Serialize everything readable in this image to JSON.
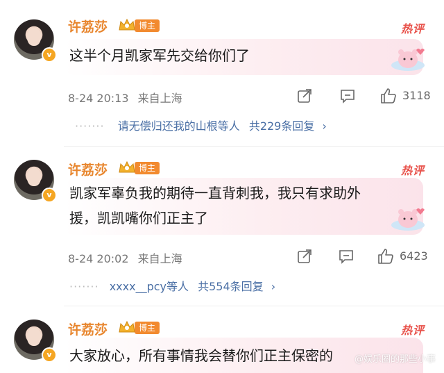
{
  "comments": [
    {
      "username": "许荔莎",
      "badge": "博主",
      "hot_label": "热评",
      "text_lines": [
        "这半个月凯家军先交给你们了"
      ],
      "timestamp": "8-24 20:13",
      "source": "来自上海",
      "likes": "3118",
      "replies_text": "请无偿归还我的山根等人",
      "replies_count": "共229条回复",
      "replies_chevron": "›"
    },
    {
      "username": "许荔莎",
      "badge": "博主",
      "hot_label": "热评",
      "text_lines": [
        "凯家军辜负我的期待一直背刺我，我只有求助外",
        "援，凯凯嘴你们正主了"
      ],
      "timestamp": "8-24 20:02",
      "source": "来自上海",
      "likes": "6423",
      "replies_text": "xxxx__pcy等人",
      "replies_count": "共554条回复",
      "replies_chevron": "›"
    },
    {
      "username": "许荔莎",
      "badge": "博主",
      "hot_label": "热评",
      "text_lines": [
        "大家放心，所有事情我会替你们正主保密的"
      ]
    }
  ],
  "verified_mark": "v",
  "reply_dots": "·······",
  "watermark": "@娱乐圈的那些小事",
  "colors": {
    "username": "#e8862e",
    "badge": "#f28a2f",
    "hot": "#e8524b",
    "reply_link": "#4a6fa5"
  },
  "icons": [
    "crown-icon",
    "share-icon",
    "comment-icon",
    "like-icon",
    "sticker-icon",
    "verified-icon"
  ]
}
